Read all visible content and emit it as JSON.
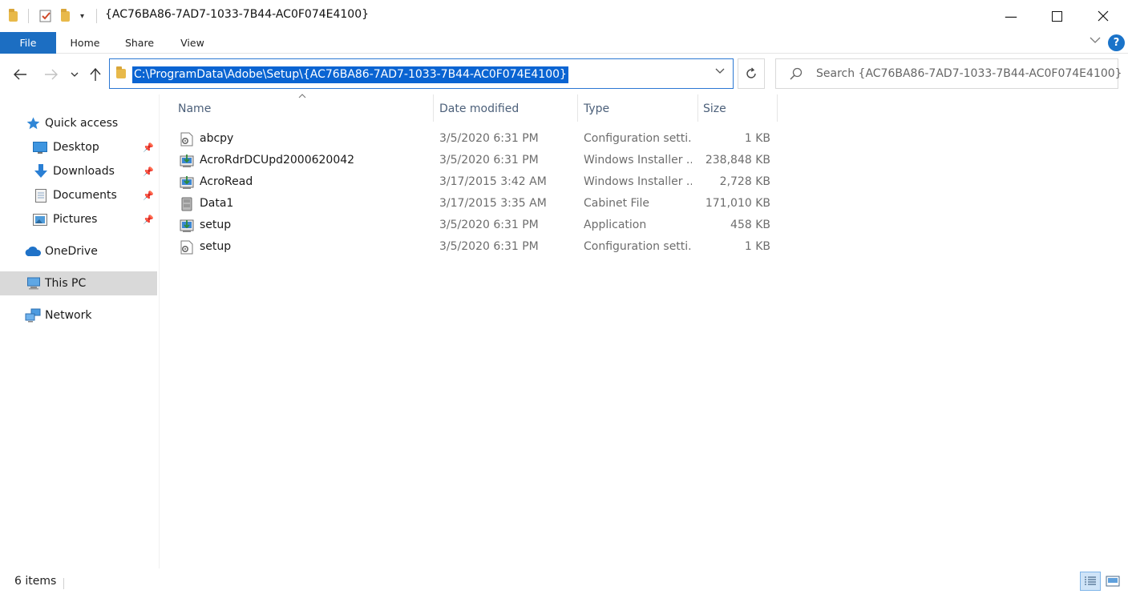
{
  "window": {
    "title": "{AC76BA86-7AD7-1033-7B44-AC0F074E4100}",
    "minimize_glyph": "—",
    "maximize_glyph": "☐",
    "close_glyph": "✕"
  },
  "ribbon": {
    "tabs": [
      {
        "label": "File"
      },
      {
        "label": "Home"
      },
      {
        "label": "Share"
      },
      {
        "label": "View"
      }
    ],
    "help_glyph": "?"
  },
  "navigation": {
    "address": "C:\\ProgramData\\Adobe\\Setup\\{AC76BA86-7AD7-1033-7B44-AC0F074E4100}",
    "search_placeholder": "Search {AC76BA86-7AD7-1033-7B44-AC0F074E4100}"
  },
  "sidebar": {
    "items": [
      {
        "label": "Quick access",
        "icon": "star-icon"
      },
      {
        "label": "Desktop",
        "icon": "desktop-icon",
        "pinned": true
      },
      {
        "label": "Downloads",
        "icon": "downloads-icon",
        "pinned": true
      },
      {
        "label": "Documents",
        "icon": "documents-icon",
        "pinned": true
      },
      {
        "label": "Pictures",
        "icon": "pictures-icon",
        "pinned": true
      },
      {
        "label": "OneDrive",
        "icon": "cloud-icon"
      },
      {
        "label": "This PC",
        "icon": "computer-icon",
        "selected": true
      },
      {
        "label": "Network",
        "icon": "network-icon"
      }
    ]
  },
  "file_list": {
    "columns": [
      "Name",
      "Date modified",
      "Type",
      "Size"
    ],
    "rows": [
      {
        "name": "abcpy",
        "date": "3/5/2020 6:31 PM",
        "type": "Configuration setti...",
        "size": "1 KB",
        "icon": "config-file-icon"
      },
      {
        "name": "AcroRdrDCUpd2000620042",
        "date": "3/5/2020 6:31 PM",
        "type": "Windows Installer ...",
        "size": "238,848 KB",
        "icon": "installer-icon"
      },
      {
        "name": "AcroRead",
        "date": "3/17/2015 3:42 AM",
        "type": "Windows Installer ...",
        "size": "2,728 KB",
        "icon": "installer-icon"
      },
      {
        "name": "Data1",
        "date": "3/17/2015 3:35 AM",
        "type": "Cabinet File",
        "size": "171,010 KB",
        "icon": "cabinet-icon"
      },
      {
        "name": "setup",
        "date": "3/5/2020 6:31 PM",
        "type": "Application",
        "size": "458 KB",
        "icon": "application-icon"
      },
      {
        "name": "setup",
        "date": "3/5/2020 6:31 PM",
        "type": "Configuration setti...",
        "size": "1 KB",
        "icon": "config-file-icon"
      }
    ]
  },
  "status_bar": {
    "item_count": "6 items"
  },
  "colors": {
    "accent": "#1c6ec2",
    "selection": "#0a64d2",
    "header_text": "#4c607a"
  }
}
